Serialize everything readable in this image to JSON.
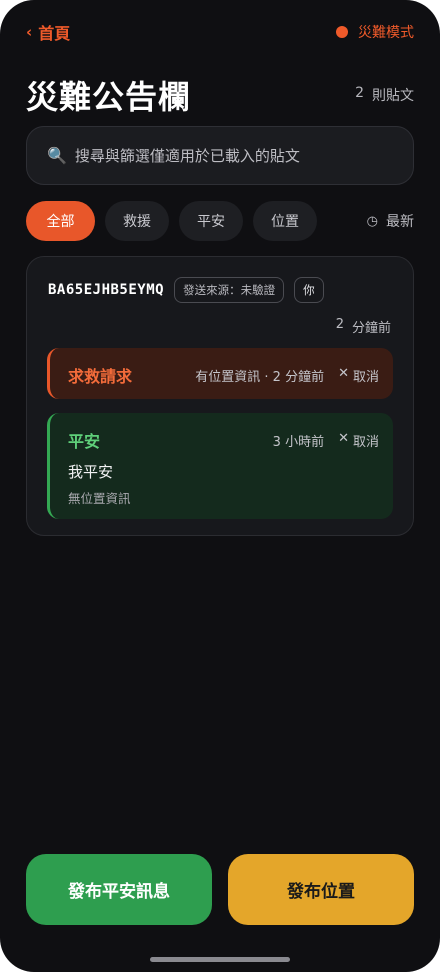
{
  "nav": {
    "back_label": "首頁",
    "mode_label": "災難模式"
  },
  "header": {
    "title": "災難公告欄",
    "count_number": "2",
    "count_unit": "則貼文"
  },
  "search": {
    "placeholder": "搜尋與篩選僅適用於已載入的貼文"
  },
  "filters": {
    "items": [
      "全部",
      "救援",
      "平安",
      "位置"
    ],
    "active": "全部",
    "sort_label": "最新"
  },
  "post": {
    "user_id": "BA65EJHB5EYMQ",
    "source_badge": "發送來源：未驗證",
    "you_badge": "你",
    "time_number": "2",
    "time_unit": "分鐘前",
    "statuses": [
      {
        "type": "rescue",
        "label": "求救請求",
        "meta": "有位置資訊 · 2 分鐘前",
        "cancel": "取消"
      },
      {
        "type": "safe",
        "label": "平安",
        "meta": "3 小時前",
        "cancel": "取消",
        "message": "我平安",
        "location": "無位置資訊"
      }
    ]
  },
  "actions": {
    "post_safe": "發布平安訊息",
    "post_location": "發布位置"
  },
  "colors": {
    "accent": "#e8572a",
    "safe": "#34a853",
    "location": "#e4a62a",
    "background": "#0f0f12"
  }
}
